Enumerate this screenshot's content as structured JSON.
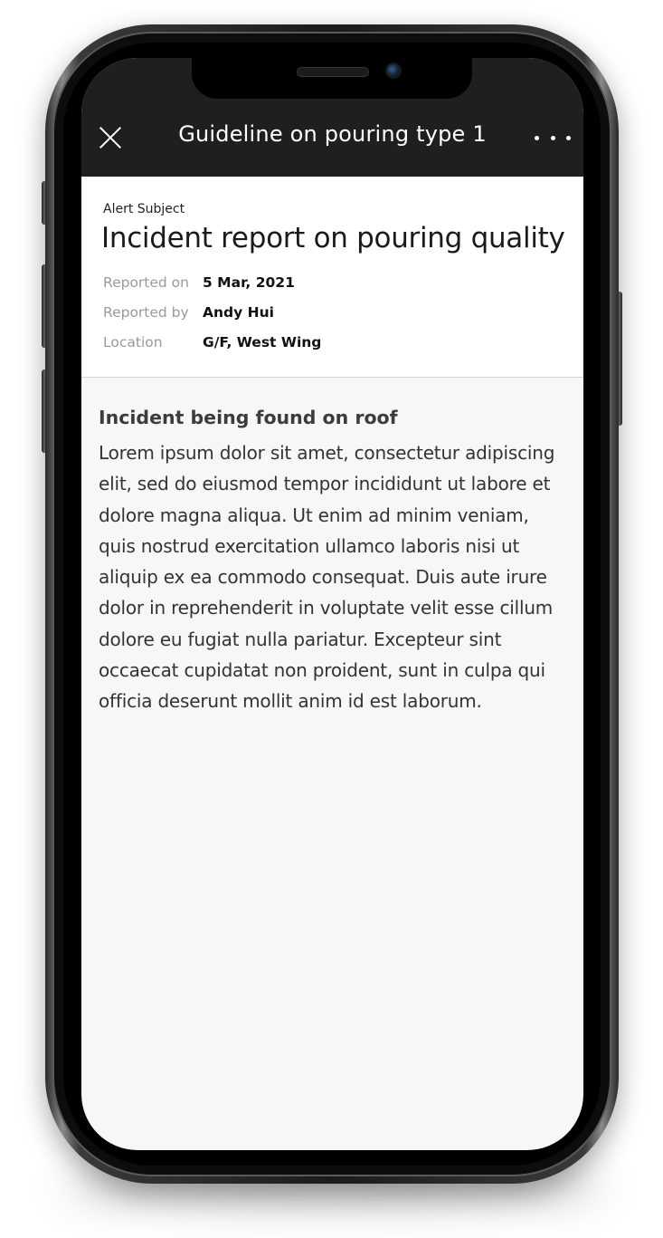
{
  "app_bar": {
    "title": "Guideline on pouring type 1",
    "close_icon": "close-icon",
    "more_icon": "more-horizontal-icon"
  },
  "alert": {
    "subject_label": "Alert Subject",
    "subject": "Incident report on pouring quality",
    "meta": [
      {
        "label": "Reported on",
        "value": "5 Mar, 2021"
      },
      {
        "label": "Reported by",
        "value": "Andy Hui"
      },
      {
        "label": "Location",
        "value": "G/F, West Wing"
      }
    ]
  },
  "content": {
    "heading": "Incident being found on roof",
    "body": "Lorem ipsum dolor sit amet, consectetur adipiscing elit, sed do eiusmod tempor incididunt ut labore et dolore magna aliqua. Ut enim ad minim veniam, quis nostrud exercitation ullamco laboris nisi ut aliquip ex ea commodo consequat. Duis aute irure dolor in reprehenderit in voluptate velit esse cillum dolore eu fugiat nulla pariatur. Excepteur sint occaecat cupidatat non proident, sunt in culpa qui officia deserunt mollit anim id est laborum."
  },
  "colors": {
    "app_bar": "#1f1f1f",
    "screen_background": "#f7f7f7",
    "card_background": "#ffffff",
    "meta_label": "#9a9a9a"
  }
}
